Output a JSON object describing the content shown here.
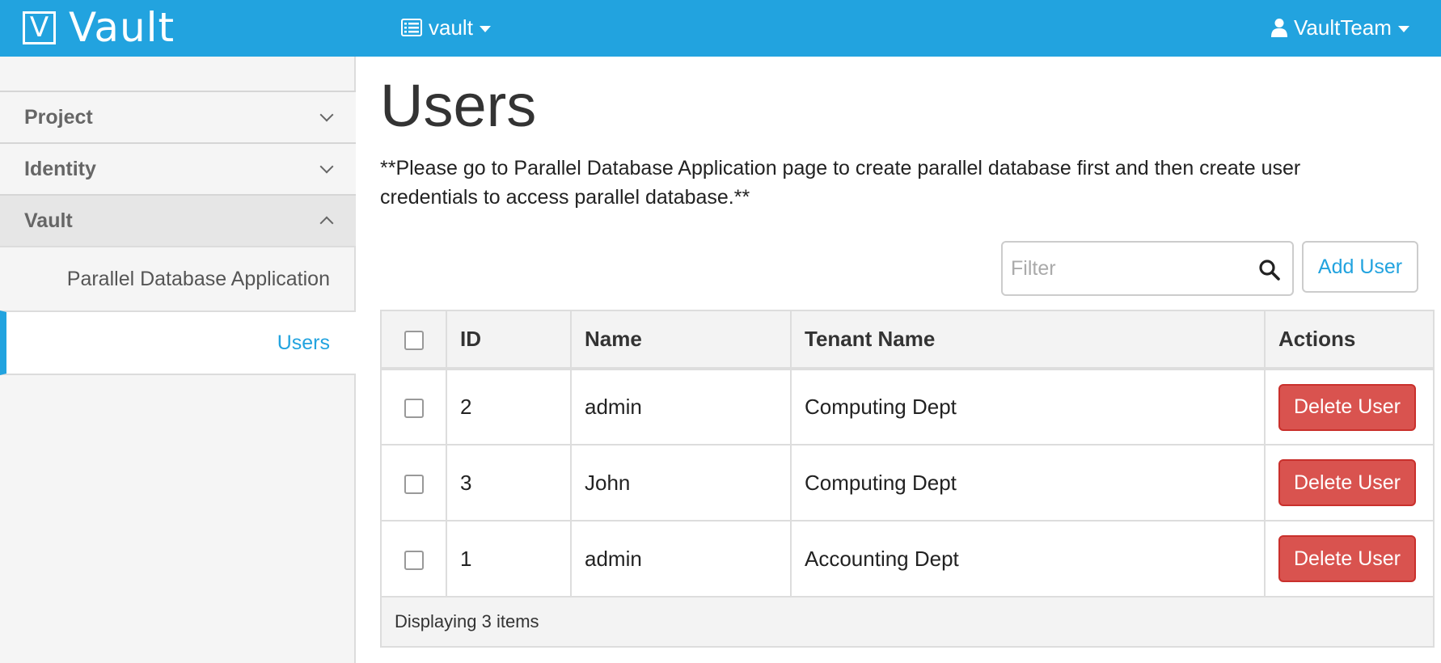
{
  "topbar": {
    "brand_mark": "V",
    "brand_name": "Vault",
    "project_menu": "vault",
    "user_menu": "VaultTeam"
  },
  "sidebar": {
    "sections": [
      {
        "label": "Project",
        "state": "collapsed"
      },
      {
        "label": "Identity",
        "state": "collapsed"
      },
      {
        "label": "Vault",
        "state": "expanded"
      }
    ],
    "vault_items": [
      {
        "label": "Parallel Database Application",
        "active": false
      },
      {
        "label": "Users",
        "active": true
      }
    ]
  },
  "main": {
    "title": "Users",
    "notice": "**Please go to Parallel Database Application page to create parallel database first and then create user credentials to access parallel database.**",
    "filter_placeholder": "Filter",
    "add_button": "Add User",
    "table": {
      "headers": [
        "ID",
        "Name",
        "Tenant Name",
        "Actions"
      ],
      "rows": [
        {
          "id": "2",
          "name": "admin",
          "tenant": "Computing Dept",
          "action": "Delete User"
        },
        {
          "id": "3",
          "name": "John",
          "tenant": "Computing Dept",
          "action": "Delete User"
        },
        {
          "id": "1",
          "name": "admin",
          "tenant": "Accounting Dept",
          "action": "Delete User"
        }
      ],
      "footer": "Displaying 3 items"
    }
  },
  "colors": {
    "brand": "#22a3df",
    "danger": "#d9534f"
  },
  "icons": {
    "project_menu": "list-icon",
    "user_menu": "user-icon",
    "filter": "search-icon"
  }
}
